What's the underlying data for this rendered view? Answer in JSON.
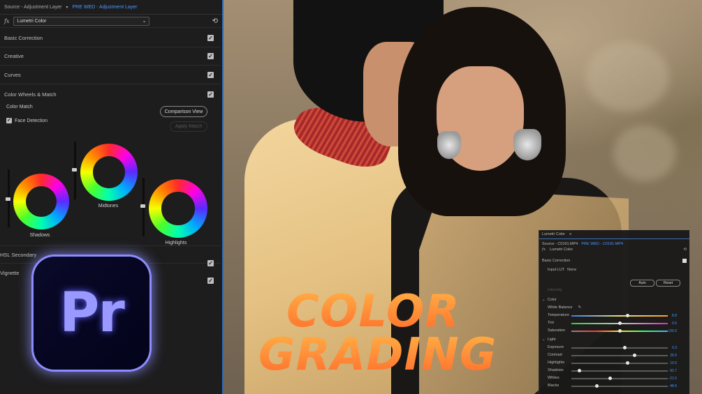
{
  "left_panel": {
    "source_label": "Source - Adjustment Layer",
    "sequence_label": "PRE WED - Adjustment Layer",
    "fx_label": "fx",
    "effect_name": "Lumetri Color",
    "sections": [
      "Basic Correction",
      "Creative",
      "Curves",
      "Color Wheels & Match"
    ],
    "color_match_label": "Color Match",
    "comparison_view_button": "Comparison View",
    "face_detection_label": "Face Detection",
    "apply_match_button": "Apply Match",
    "wheels": [
      "Shadows",
      "Midtones",
      "Highlights"
    ],
    "hsl_secondary": "HSL Secondary",
    "vignette": "Vignette"
  },
  "logo_text": "Pr",
  "headline": {
    "line1": "COLOR",
    "line2": "GRADING"
  },
  "right_panel": {
    "title": "Lumetri Color",
    "source_label": "Source - C0191.MP4",
    "sequence_label": "PRE WED - C0191.MP4",
    "fx_label": "fx",
    "effect_name": "Lumetri Color",
    "basic_correction": "Basic Correction",
    "input_lut_label": "Input LUT",
    "input_lut_value": "None",
    "intensity_label": "Intensity",
    "auto_button": "Auto",
    "reset_button": "Reset",
    "color_section": "Color",
    "white_balance_label": "White Balance",
    "light_section": "Light",
    "color_sliders": [
      {
        "label": "Temperature",
        "value": "8.8",
        "level": 0.58
      },
      {
        "label": "Tint",
        "value": "0.0",
        "level": 0.5
      },
      {
        "label": "Saturation",
        "value": "100.0",
        "level": 0.5
      }
    ],
    "light_sliders": [
      {
        "label": "Exposure",
        "value": "0.3",
        "level": 0.55
      },
      {
        "label": "Contrast",
        "value": "26.5",
        "level": 0.65
      },
      {
        "label": "Highlights",
        "value": "10.0",
        "level": 0.58
      },
      {
        "label": "Shadows",
        "value": "-92.7",
        "level": 0.08
      },
      {
        "label": "Whites",
        "value": "-21.5",
        "level": 0.4
      },
      {
        "label": "Blacks",
        "value": "-48.6",
        "level": 0.26
      }
    ]
  },
  "colors": {
    "accent_blue": "#4a97ff",
    "headline_orange": "#ff8a3a",
    "logo_purple": "#9999ff"
  }
}
